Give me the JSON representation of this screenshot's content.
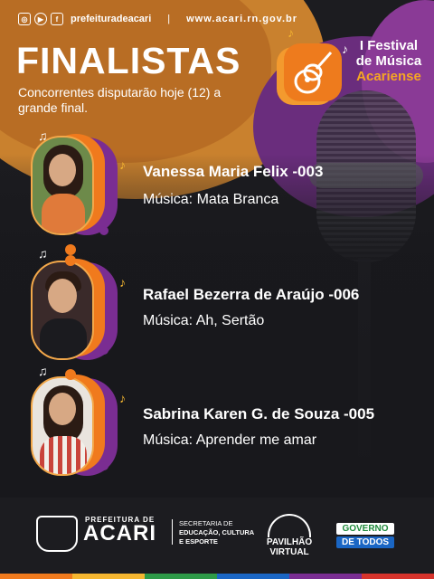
{
  "header": {
    "handle": "prefeituradeacari",
    "separator": "|",
    "site": "www.acari.rn.gov.br",
    "icons": [
      "instagram-icon",
      "youtube-icon",
      "facebook-icon"
    ]
  },
  "title": "FINALISTAS",
  "subtitle": "Concorrentes disputarão hoje (12) a grande final.",
  "festival": {
    "line1": "I Festival",
    "line2": "de Música",
    "line3": "Acariense",
    "icon": "guitar-icon"
  },
  "finalists": [
    {
      "name": "Vanessa Maria Felix -003",
      "song": "Música: Mata Branca"
    },
    {
      "name": "Rafael Bezerra de Araújo -006",
      "song": "Música: Ah, Sertão"
    },
    {
      "name": "Sabrina Karen G. de Souza -005",
      "song": "Música: Aprender me amar"
    }
  ],
  "footer": {
    "prefeitura_small": "PREFEITURA DE",
    "prefeitura_big": "ACARI",
    "secretaria_l1": "SECRETARIA DE",
    "secretaria_l2": "EDUCAÇÃO, CULTURA",
    "secretaria_l3": "E ESPORTE",
    "pavilhao_l1": "PAVILHÃO",
    "pavilhao_l2": "VIRTUAL",
    "governo_l1": "GOVERNO",
    "governo_l2": "DE TODOS"
  },
  "colors": {
    "orange": "#f07a1d",
    "purple": "#7a2d92",
    "gold": "#f5a623",
    "background": "#1c1c20"
  }
}
